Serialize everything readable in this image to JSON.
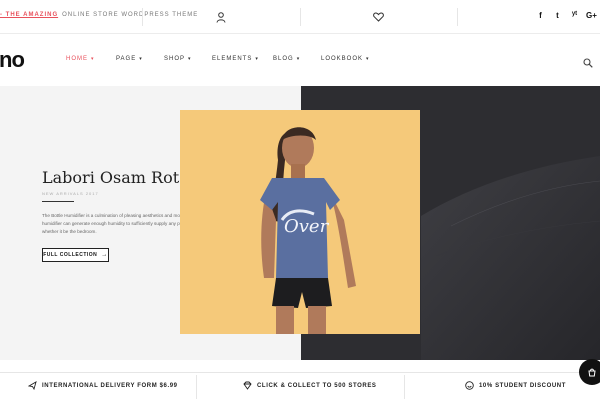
{
  "topbar": {
    "promo_accent": "- THE AMAZING",
    "promo_rest": "ONLINE STORE WORDPRESS THEME",
    "icons": [
      "user-icon",
      "heart-icon"
    ],
    "social": [
      "f",
      "t",
      "yt",
      "G+"
    ]
  },
  "nav": {
    "logo": "no",
    "items": [
      {
        "label": "HOME",
        "active": true
      },
      {
        "label": "PAGE",
        "active": false
      },
      {
        "label": "SHOP",
        "active": false
      },
      {
        "label": "ELEMENTS",
        "active": false
      },
      {
        "label": "BLOG",
        "active": false
      },
      {
        "label": "LOOKBOOK",
        "active": false
      }
    ],
    "search_icon": "search-icon"
  },
  "hero": {
    "title": "Labori Osam Rotatume",
    "subtitle": "NEW ARRIVALS 2017",
    "description": "The Bottle Humidifier is a culmination of pleasing aesthetics and modern utility. The humidifier can generate enough humidity to sufficiently supply any personal space, whether it be the bedroom.",
    "button_label": "FULL COLLECTION",
    "photo_text": "Over"
  },
  "features": [
    {
      "label": "INTERNATIONAL DELIVERY FORM $6.99",
      "icon": "plane-icon"
    },
    {
      "label": "CLICK & COLLECT TO 500 STORES",
      "icon": "diamond-icon"
    },
    {
      "label": "10% STUDENT DISCOUNT",
      "icon": "smile-icon"
    }
  ],
  "colors": {
    "accent": "#e8505b",
    "hero_left_bg": "#f4f4f4",
    "hero_right_bg": "#2d2d31",
    "photo_bg": "#f5c97a"
  }
}
